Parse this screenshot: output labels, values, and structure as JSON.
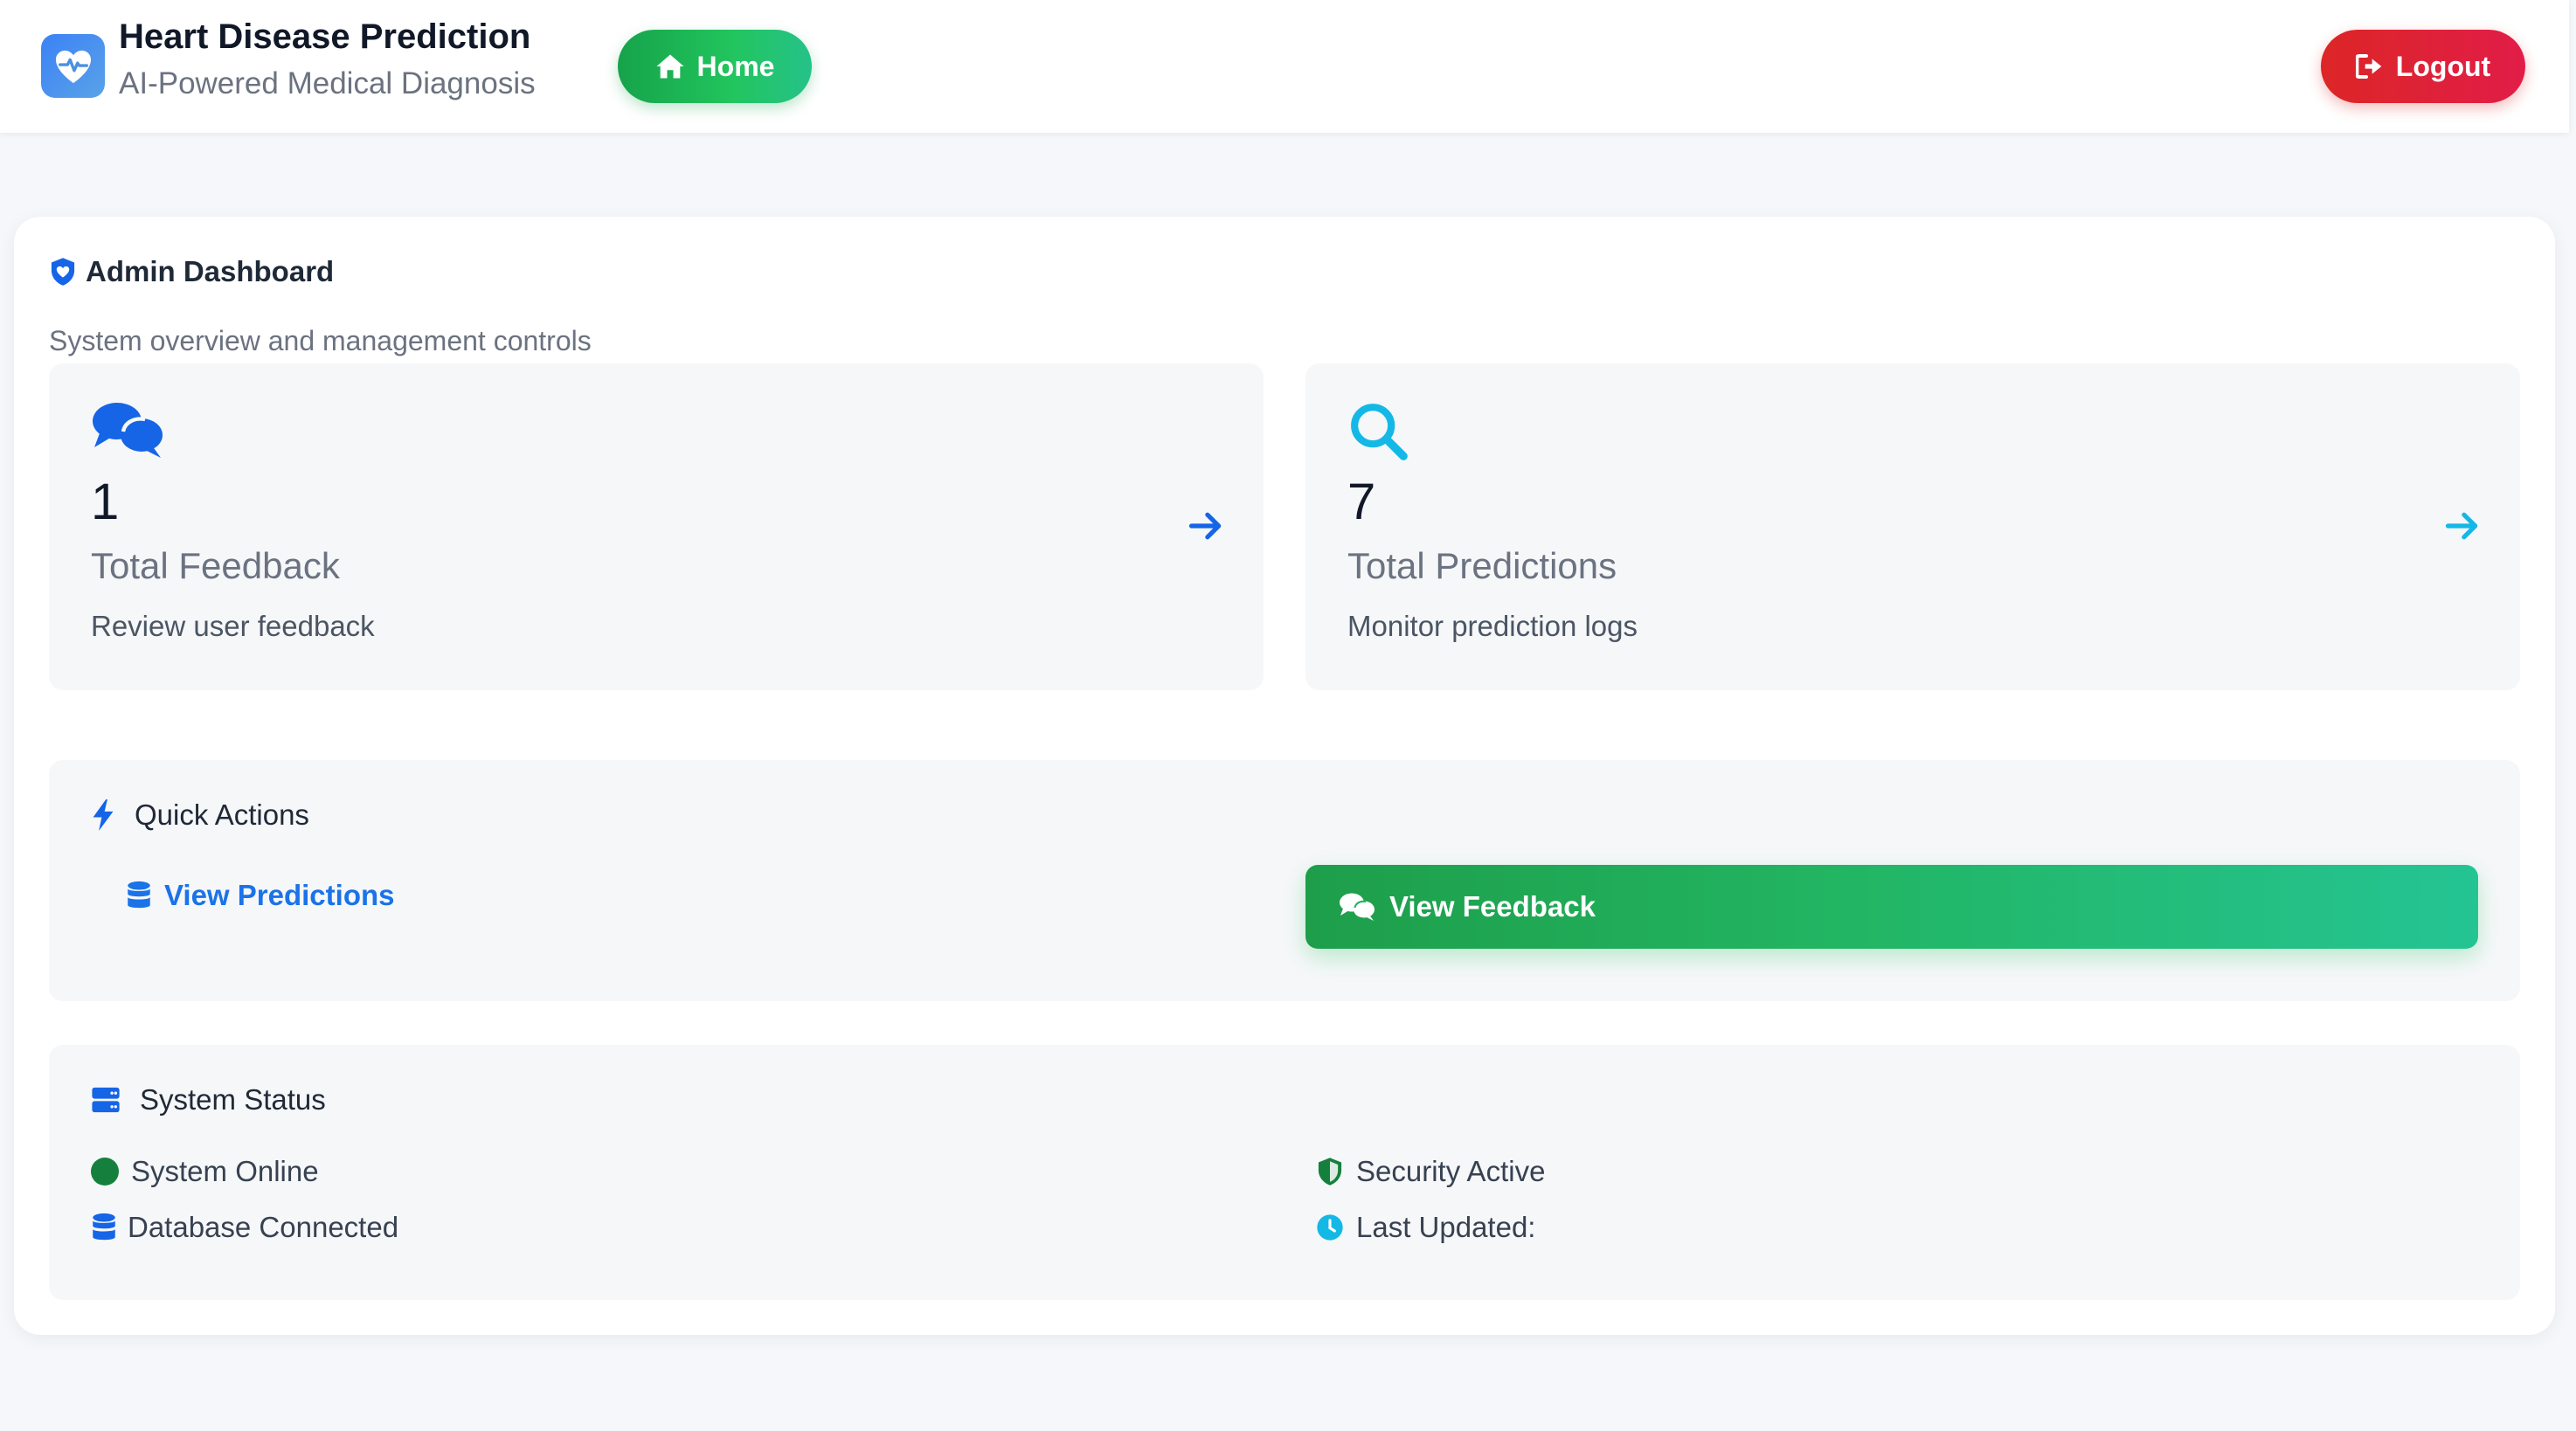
{
  "app": {
    "title": "Heart Disease Prediction",
    "subtitle": "AI-Powered Medical Diagnosis",
    "logo_icon": "heart-pulse-icon"
  },
  "nav": {
    "home_label": "Home",
    "logout_label": "Logout"
  },
  "dashboard": {
    "title": "Admin Dashboard",
    "subtitle": "System overview and management controls"
  },
  "stats": [
    {
      "icon": "comments-icon",
      "value": "1",
      "label": "Total Feedback",
      "description": "Review user feedback",
      "color": "#1565e6"
    },
    {
      "icon": "search-icon",
      "value": "7",
      "label": "Total Predictions",
      "description": "Monitor prediction logs",
      "color": "#14b8e6"
    }
  ],
  "quick_actions": {
    "title": "Quick Actions",
    "view_predictions_label": "View Predictions",
    "view_feedback_label": "View Feedback"
  },
  "system_status": {
    "title": "System Status",
    "items": [
      {
        "icon": "status-dot-icon",
        "label": "System Online"
      },
      {
        "icon": "database-icon",
        "label": "Database Connected"
      },
      {
        "icon": "shield-icon",
        "label": "Security Active"
      },
      {
        "icon": "clock-icon",
        "label": "Last Updated:"
      }
    ]
  },
  "colors": {
    "primary_blue": "#1a73e8",
    "success_green": "#22c55e",
    "danger_red": "#dc2626",
    "cyan": "#14b8e6"
  }
}
